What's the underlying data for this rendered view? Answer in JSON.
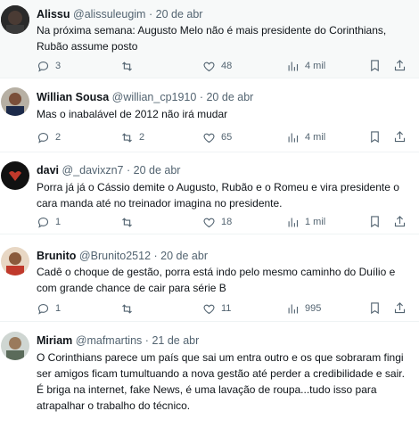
{
  "colors": {
    "text": "#0f1419",
    "muted": "#536471",
    "border": "#eff3f4",
    "highlight_bg": "#f7f9f9"
  },
  "tweets": [
    {
      "name": "Alissu",
      "handle": "@alissuleugim",
      "dot": "·",
      "time": "20 de abr",
      "text": "Na próxima semana: Augusto Melo não é mais presidente do Corinthians, Rubão assume posto",
      "replies": "3",
      "retweets": "",
      "likes": "48",
      "views": "4 mil"
    },
    {
      "name": "Willian Sousa",
      "handle": "@willian_cp1910",
      "dot": "·",
      "time": "20 de abr",
      "text": "Mas o inabalável de 2012 não irá mudar",
      "replies": "2",
      "retweets": "2",
      "likes": "65",
      "views": "4 mil"
    },
    {
      "name": "davi",
      "handle": "@_davixzn7",
      "dot": "·",
      "time": "20 de abr",
      "text": "Porra já já o Cássio demite o Augusto, Rubão e o Romeu e vira presidente o cara manda até no treinador imagina no presidente.",
      "replies": "1",
      "retweets": "",
      "likes": "18",
      "views": "1 mil"
    },
    {
      "name": "Brunito",
      "handle": "@Brunito2512",
      "dot": "·",
      "time": "20 de abr",
      "text": "Cadê o choque de gestão, porra está indo pelo mesmo caminho do Duílio e com grande chance de cair para série B",
      "replies": "1",
      "retweets": "",
      "likes": "11",
      "views": "995"
    },
    {
      "name": "Miriam",
      "handle": "@mafmartins",
      "dot": "·",
      "time": "21 de abr",
      "text": "O Corinthians parece um país que sai um entra outro e os que sobraram fingi ser amigos ficam tumultuando a nova gestão até perder a credibilidade e sair.  É briga na internet, fake News, é uma lavação de roupa...tudo isso para atrapalhar o trabalho do técnico.",
      "replies": "",
      "retweets": "",
      "likes": "",
      "views": ""
    }
  ]
}
